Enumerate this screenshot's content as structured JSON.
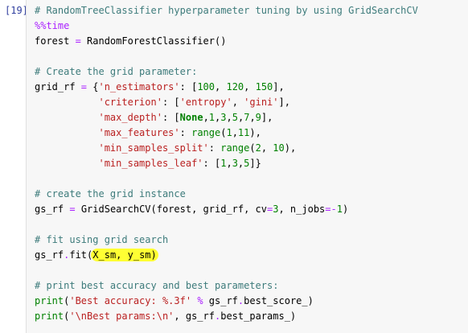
{
  "cell": {
    "prompt": "[19]",
    "lines": [
      [
        {
          "t": "# RandomTreeClassifier hyperparameter tuning by using GridSearchCV",
          "k": "comment"
        }
      ],
      [
        {
          "t": "%%time",
          "k": "magic"
        }
      ],
      [
        {
          "t": "forest "
        },
        {
          "t": "=",
          "k": "op"
        },
        {
          "t": " RandomForestClassifier()"
        }
      ],
      [],
      [
        {
          "t": "# Create the grid parameter:",
          "k": "comment"
        }
      ],
      [
        {
          "t": "grid_rf "
        },
        {
          "t": "=",
          "k": "op"
        },
        {
          "t": " {"
        },
        {
          "t": "'n_estimators'",
          "k": "string"
        },
        {
          "t": ": ["
        },
        {
          "t": "100",
          "k": "number"
        },
        {
          "t": ", "
        },
        {
          "t": "120",
          "k": "number"
        },
        {
          "t": ", "
        },
        {
          "t": "150",
          "k": "number"
        },
        {
          "t": "],"
        }
      ],
      [
        {
          "t": "           "
        },
        {
          "t": "'criterion'",
          "k": "string"
        },
        {
          "t": ": ["
        },
        {
          "t": "'entropy'",
          "k": "string"
        },
        {
          "t": ", "
        },
        {
          "t": "'gini'",
          "k": "string"
        },
        {
          "t": "],"
        }
      ],
      [
        {
          "t": "           "
        },
        {
          "t": "'max_depth'",
          "k": "string"
        },
        {
          "t": ": ["
        },
        {
          "t": "None",
          "k": "keyword"
        },
        {
          "t": ","
        },
        {
          "t": "1",
          "k": "number"
        },
        {
          "t": ","
        },
        {
          "t": "3",
          "k": "number"
        },
        {
          "t": ","
        },
        {
          "t": "5",
          "k": "number"
        },
        {
          "t": ","
        },
        {
          "t": "7",
          "k": "number"
        },
        {
          "t": ","
        },
        {
          "t": "9",
          "k": "number"
        },
        {
          "t": "],"
        }
      ],
      [
        {
          "t": "           "
        },
        {
          "t": "'max_features'",
          "k": "string"
        },
        {
          "t": ": "
        },
        {
          "t": "range",
          "k": "builtin"
        },
        {
          "t": "("
        },
        {
          "t": "1",
          "k": "number"
        },
        {
          "t": ","
        },
        {
          "t": "11",
          "k": "number"
        },
        {
          "t": "),"
        }
      ],
      [
        {
          "t": "           "
        },
        {
          "t": "'min_samples_split'",
          "k": "string"
        },
        {
          "t": ": "
        },
        {
          "t": "range",
          "k": "builtin"
        },
        {
          "t": "("
        },
        {
          "t": "2",
          "k": "number"
        },
        {
          "t": ", "
        },
        {
          "t": "10",
          "k": "number"
        },
        {
          "t": "),"
        }
      ],
      [
        {
          "t": "           "
        },
        {
          "t": "'min_samples_leaf'",
          "k": "string"
        },
        {
          "t": ": ["
        },
        {
          "t": "1",
          "k": "number"
        },
        {
          "t": ","
        },
        {
          "t": "3",
          "k": "number"
        },
        {
          "t": ","
        },
        {
          "t": "5",
          "k": "number"
        },
        {
          "t": "]}"
        }
      ],
      [],
      [
        {
          "t": "# create the grid instance",
          "k": "comment"
        }
      ],
      [
        {
          "t": "gs_rf "
        },
        {
          "t": "=",
          "k": "op"
        },
        {
          "t": " GridSearchCV(forest, grid_rf, cv"
        },
        {
          "t": "=",
          "k": "op"
        },
        {
          "t": "3",
          "k": "number"
        },
        {
          "t": ", n_jobs"
        },
        {
          "t": "=-",
          "k": "op"
        },
        {
          "t": "1",
          "k": "number"
        },
        {
          "t": ")"
        }
      ],
      [],
      [
        {
          "t": "# fit using grid search",
          "k": "comment"
        }
      ],
      [
        {
          "t": "gs_rf"
        },
        {
          "t": ".",
          "k": "op"
        },
        {
          "t": "fit("
        },
        {
          "t": "X_sm, y_sm)",
          "k": "hl"
        }
      ],
      [],
      [
        {
          "t": "# print best accuracy and best parameters:",
          "k": "comment"
        }
      ],
      [
        {
          "t": "print",
          "k": "builtin"
        },
        {
          "t": "("
        },
        {
          "t": "'Best accuracy: %.3f'",
          "k": "string"
        },
        {
          "t": " "
        },
        {
          "t": "%",
          "k": "op"
        },
        {
          "t": " gs_rf"
        },
        {
          "t": ".",
          "k": "op"
        },
        {
          "t": "best_score_)"
        }
      ],
      [
        {
          "t": "print",
          "k": "builtin"
        },
        {
          "t": "("
        },
        {
          "t": "'\\nBest params:\\n'",
          "k": "string"
        },
        {
          "t": ", gs_rf"
        },
        {
          "t": ".",
          "k": "op"
        },
        {
          "t": "best_params_)"
        }
      ]
    ]
  },
  "colors": {
    "background": "#ffffff",
    "code_background": "#f7f7f7",
    "prompt": "#303f9f",
    "comment": "#3d7b7b",
    "magic": "#aa22ff",
    "string": "#ba2121",
    "number": "#008000",
    "highlight": "#ffff33"
  }
}
